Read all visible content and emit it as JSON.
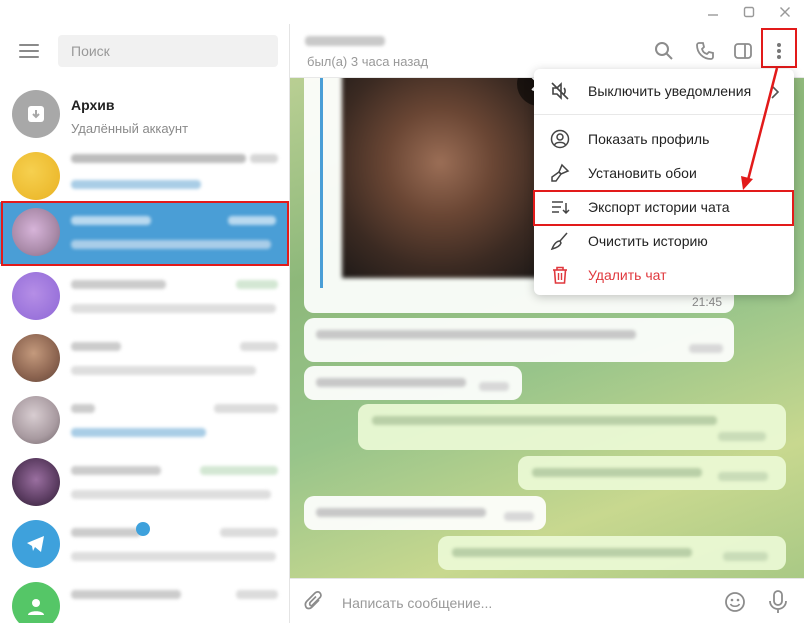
{
  "search": {
    "placeholder": "Поиск"
  },
  "sidebar": {
    "archive": {
      "title": "Архив",
      "subtitle": "Удалённый аккаунт"
    }
  },
  "header": {
    "status": "был(а) 3 часа назад"
  },
  "messages": {
    "photo_time": "21:45"
  },
  "input": {
    "placeholder": "Написать сообщение..."
  },
  "menu": {
    "items": [
      {
        "label": "Выключить уведомления",
        "icon": "mute-icon"
      },
      {
        "label": "Показать профиль",
        "icon": "profile-icon"
      },
      {
        "label": "Установить обои",
        "icon": "brush-icon"
      },
      {
        "label": "Экспорт истории чата",
        "icon": "export-icon"
      },
      {
        "label": "Очистить историю",
        "icon": "broom-icon"
      },
      {
        "label": "Удалить чат",
        "icon": "trash-icon"
      }
    ]
  },
  "colors": {
    "accent": "#4a9ed6",
    "highlight_red": "#e21a1a",
    "danger": "#e0393e"
  }
}
